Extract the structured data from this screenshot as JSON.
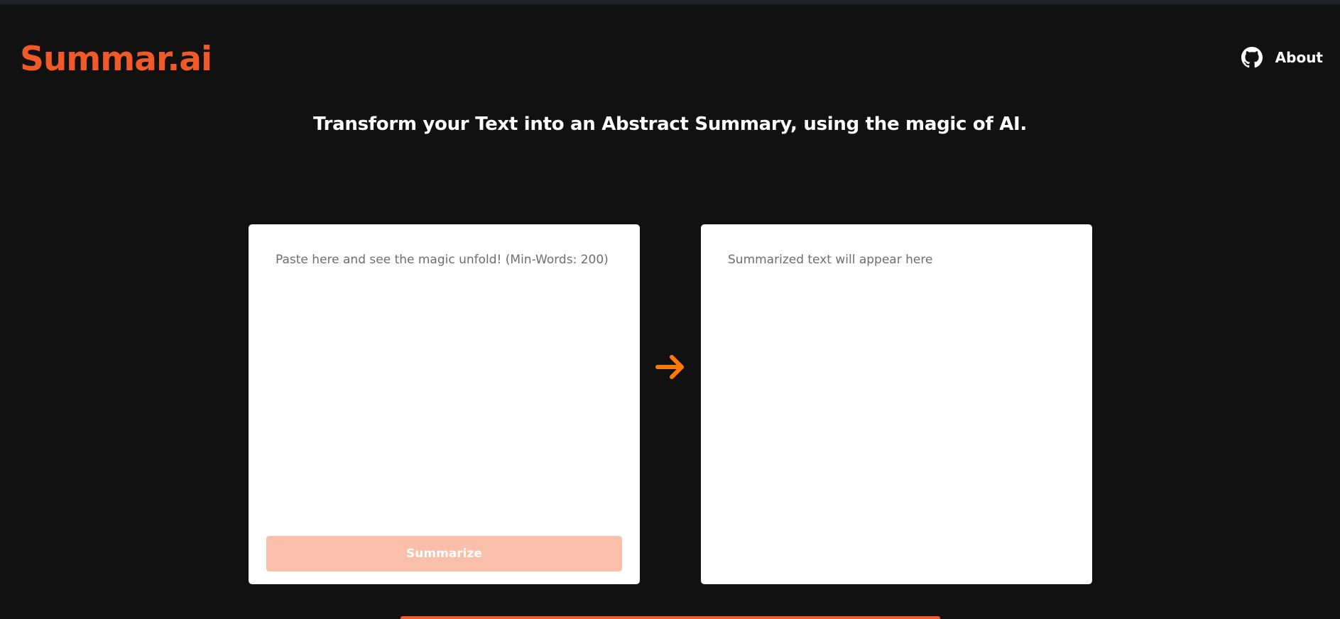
{
  "header": {
    "logo": "Summar.ai",
    "about_label": "About",
    "github_icon": "github-icon"
  },
  "tagline": "Transform your Text into an Abstract Summary, using the magic of AI.",
  "input_panel": {
    "placeholder": "Paste here and see the magic unfold! (Min-Words: 200)",
    "value": "",
    "button_label": "Summarize"
  },
  "output_panel": {
    "placeholder": "Summarized text will appear here"
  },
  "icons": {
    "arrow": "arrow-right-icon"
  },
  "colors": {
    "background": "#111111",
    "accent": "#f05a28",
    "arrow": "#ff7a00",
    "button_disabled": "#f9bfaa",
    "panel": "#ffffff"
  }
}
